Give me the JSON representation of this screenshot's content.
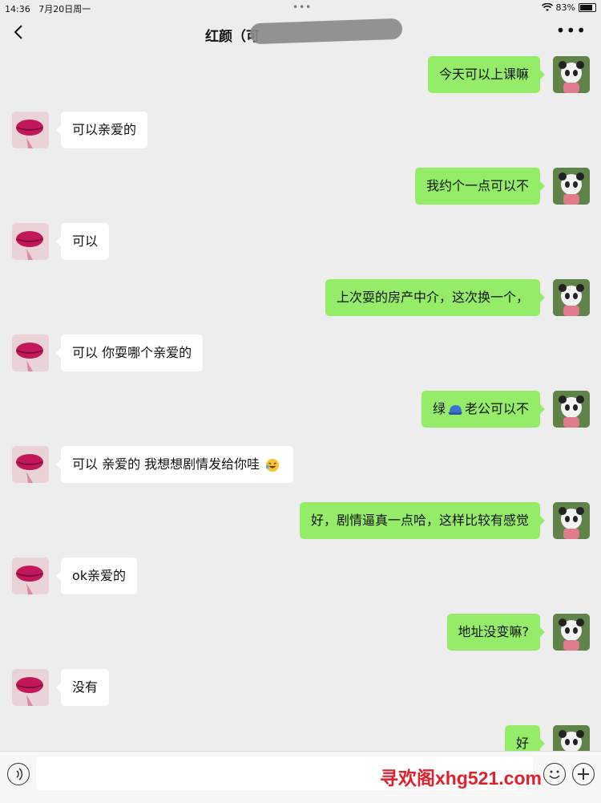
{
  "status_bar": {
    "time": "14:36",
    "date": "7月20日周一",
    "battery": "83%"
  },
  "header": {
    "title": "红颜（可"
  },
  "messages": [
    {
      "side": "right",
      "text": "今天可以上课嘛"
    },
    {
      "side": "left",
      "text": "可以亲爱的"
    },
    {
      "side": "right",
      "text": "我约个一点可以不"
    },
    {
      "side": "left",
      "text": "可以"
    },
    {
      "side": "right",
      "text": "上次耍的房产中介，这次换一个，"
    },
    {
      "side": "left",
      "text": "可以 你耍哪个亲爱的"
    },
    {
      "side": "right",
      "text_before": "绿",
      "text_after": "老公可以不",
      "emoji": "blue-cap"
    },
    {
      "side": "left",
      "text": "可以 亲爱的 我想想剧情发给你哇",
      "emoji": "laughing-tears"
    },
    {
      "side": "right",
      "text": "好，剧情逼真一点哈，这样比较有感觉"
    },
    {
      "side": "left",
      "text": "ok亲爱的"
    },
    {
      "side": "right",
      "text": "地址没变嘛?"
    },
    {
      "side": "left",
      "text": "没有"
    },
    {
      "side": "right",
      "text": "好"
    }
  ],
  "watermark": "寻欢阁xhg521.com",
  "colors": {
    "sent_bubble": "#95ec69",
    "received_bubble": "#ffffff",
    "background": "#ededed",
    "watermark": "#e0202a"
  }
}
